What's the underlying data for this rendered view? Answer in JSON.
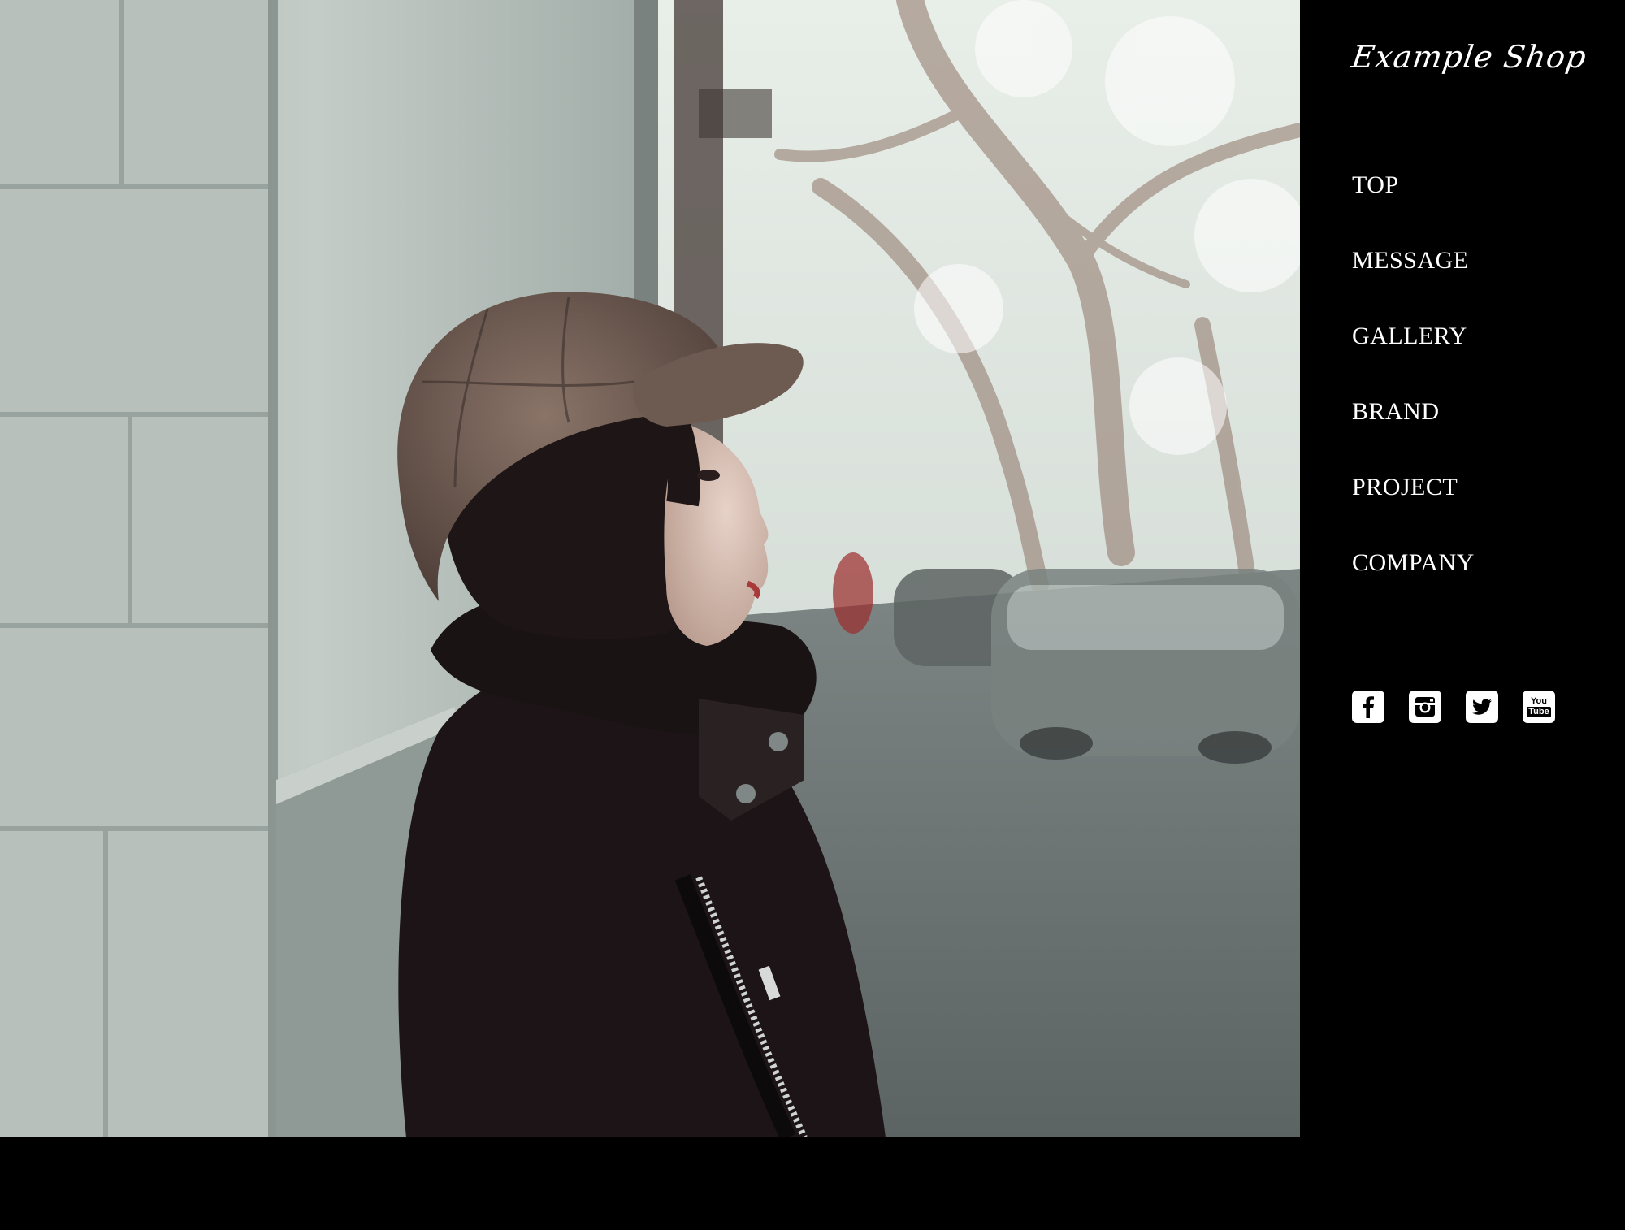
{
  "brand": {
    "logo_text": "Example Shop"
  },
  "nav": {
    "items": [
      {
        "label": "TOP"
      },
      {
        "label": "MESSAGE"
      },
      {
        "label": "GALLERY"
      },
      {
        "label": "BRAND"
      },
      {
        "label": "PROJECT"
      },
      {
        "label": "COMPANY"
      }
    ]
  },
  "social": {
    "items": [
      {
        "icon": "facebook-icon"
      },
      {
        "icon": "instagram-icon"
      },
      {
        "icon": "twitter-icon"
      },
      {
        "icon": "youtube-icon",
        "text_top": "You",
        "text_bottom": "Tube"
      }
    ]
  },
  "colors": {
    "sidebar_bg": "#000000",
    "nav_text": "#ffffff"
  }
}
